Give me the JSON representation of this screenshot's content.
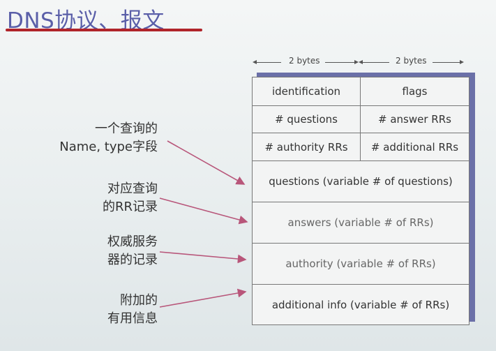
{
  "title": "DNS协议、报文",
  "bytes": {
    "left": "2 bytes",
    "right": "2 bytes"
  },
  "fields": {
    "identification": "identification",
    "flags": "flags",
    "questions_count": "# questions",
    "answer_rrs": "# answer RRs",
    "authority_rrs": "# authority RRs",
    "additional_rrs": "# additional RRs",
    "questions": "questions (variable # of questions)",
    "answers": "answers (variable # of RRs)",
    "authority": "authority (variable # of RRs)",
    "additional": "additional info (variable # of RRs)"
  },
  "annotations": {
    "name_type_line1": "一个查询的",
    "name_type_line2": "Name, type字段",
    "rr_line1": "对应查询",
    "rr_line2": "的RR记录",
    "authority_line1": "权威服务",
    "authority_line2": "器的记录",
    "additional_line1": "附加的",
    "additional_line2": "有用信息"
  },
  "colors": {
    "title": "#5a5fa8",
    "underline": "#b0242a",
    "shadow": "#6b70a8",
    "arrow": "#b8567a"
  }
}
